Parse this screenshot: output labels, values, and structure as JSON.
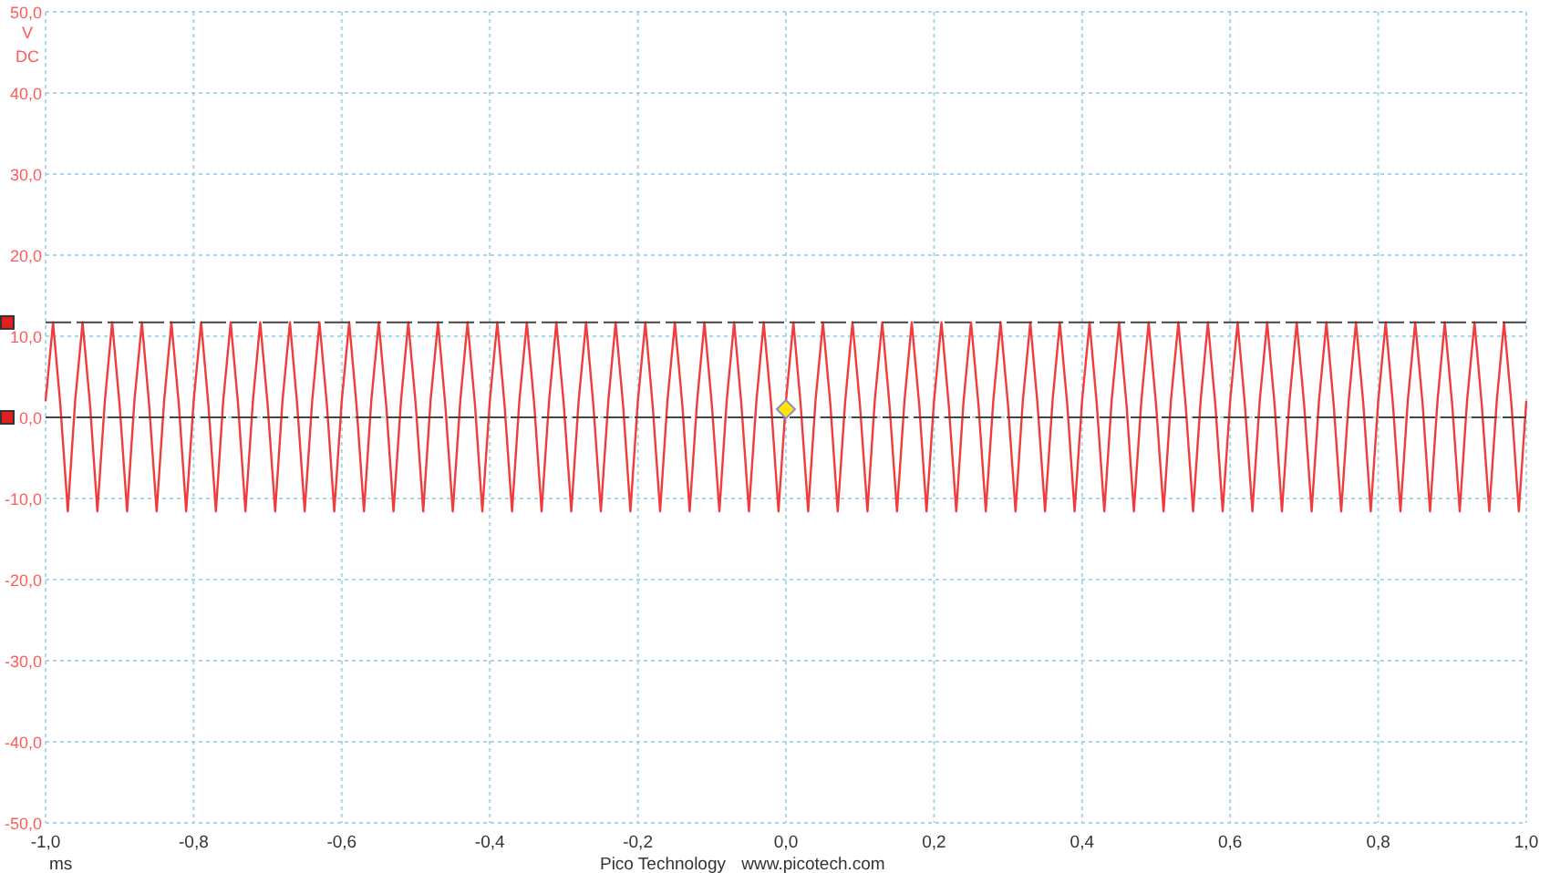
{
  "scope": {
    "coupling": "DC",
    "chart_data": {
      "type": "line",
      "xlabel": "ms",
      "ylabel": "V",
      "xlim": [
        -1,
        1
      ],
      "ylim": [
        -50,
        50
      ],
      "grid": true,
      "ref_lines": [
        {
          "axis": "y",
          "value": 11.7
        },
        {
          "axis": "y",
          "value": 0
        }
      ],
      "xticks": [
        {
          "value": -1,
          "label": "-1,0"
        },
        {
          "value": -0.8,
          "label": "-0,8"
        },
        {
          "value": -0.6,
          "label": "-0,6"
        },
        {
          "value": -0.4,
          "label": "-0,4"
        },
        {
          "value": -0.2,
          "label": "-0,2"
        },
        {
          "value": 0,
          "label": "0,0"
        },
        {
          "value": 0.2,
          "label": "0,2"
        },
        {
          "value": 0.4,
          "label": "0,4"
        },
        {
          "value": 0.6,
          "label": "0,6"
        },
        {
          "value": 0.8,
          "label": "0,8"
        },
        {
          "value": 1,
          "label": "1,0"
        }
      ],
      "yticks": [
        {
          "value": 50,
          "label": "50,0"
        },
        {
          "value": 40,
          "label": "40,0"
        },
        {
          "value": 30,
          "label": "30,0"
        },
        {
          "value": 20,
          "label": "20,0"
        },
        {
          "value": 10,
          "label": "10,0"
        },
        {
          "value": 0,
          "label": "0,0"
        },
        {
          "value": -10,
          "label": "-10,0"
        },
        {
          "value": -20,
          "label": "-20,0"
        },
        {
          "value": -30,
          "label": "-30,0"
        },
        {
          "value": -40,
          "label": "-40,0"
        },
        {
          "value": -50,
          "label": "-50,0"
        }
      ],
      "x": [
        -1,
        -0.99,
        -0.98,
        -0.97,
        -0.96,
        -0.95,
        -0.94,
        -0.93,
        -0.92,
        -0.91,
        -0.9,
        -0.89,
        -0.88,
        -0.87,
        -0.86,
        -0.85,
        -0.84,
        -0.83,
        -0.82,
        -0.81,
        -0.8,
        -0.79,
        -0.78,
        -0.77,
        -0.76,
        -0.75,
        -0.74,
        -0.73,
        -0.72,
        -0.71,
        -0.7,
        -0.69,
        -0.68,
        -0.67,
        -0.66,
        -0.65,
        -0.64,
        -0.63,
        -0.62,
        -0.61,
        -0.6,
        -0.59,
        -0.58,
        -0.57,
        -0.56,
        -0.55,
        -0.54,
        -0.53,
        -0.52,
        -0.51,
        -0.5,
        -0.49,
        -0.48,
        -0.47,
        -0.46,
        -0.45,
        -0.44,
        -0.43,
        -0.42,
        -0.41,
        -0.4,
        -0.39,
        -0.38,
        -0.37,
        -0.36,
        -0.35,
        -0.34,
        -0.33,
        -0.32,
        -0.31,
        -0.3,
        -0.29,
        -0.28,
        -0.27,
        -0.26,
        -0.25,
        -0.24,
        -0.23,
        -0.22,
        -0.21,
        -0.2,
        -0.19,
        -0.18,
        -0.17,
        -0.16,
        -0.15,
        -0.14,
        -0.13,
        -0.12,
        -0.11,
        -0.1,
        -0.09,
        -0.08,
        -0.07,
        -0.06,
        -0.05,
        -0.04,
        -0.03,
        -0.02,
        -0.01,
        0,
        0.01,
        0.02,
        0.03,
        0.04,
        0.05,
        0.06,
        0.07,
        0.08,
        0.09,
        0.1,
        0.11,
        0.12,
        0.13,
        0.14,
        0.15,
        0.16,
        0.17,
        0.18,
        0.19,
        0.2,
        0.21,
        0.22,
        0.23,
        0.24,
        0.25,
        0.26,
        0.27,
        0.28,
        0.29,
        0.3,
        0.31,
        0.32,
        0.33,
        0.34,
        0.35,
        0.36,
        0.37,
        0.38,
        0.39,
        0.4,
        0.41,
        0.42,
        0.43,
        0.44,
        0.45,
        0.46,
        0.47,
        0.48,
        0.49,
        0.5,
        0.51,
        0.52,
        0.53,
        0.54,
        0.55,
        0.56,
        0.57,
        0.58,
        0.59,
        0.6,
        0.61,
        0.62,
        0.63,
        0.64,
        0.65,
        0.66,
        0.67,
        0.68,
        0.69,
        0.7,
        0.71,
        0.72,
        0.73,
        0.74,
        0.75,
        0.76,
        0.77,
        0.78,
        0.79,
        0.8,
        0.81,
        0.82,
        0.83,
        0.84,
        0.85,
        0.86,
        0.87,
        0.88,
        0.89,
        0.9,
        0.91,
        0.92,
        0.93,
        0.94,
        0.95,
        0.96,
        0.97,
        0.98,
        0.99,
        1
      ],
      "series": [
        {
          "color": "#f03c3c",
          "values": [
            2,
            11.7,
            1.5,
            -11.6,
            2,
            11.7,
            1.5,
            -11.6,
            2,
            11.7,
            1.5,
            -11.6,
            2,
            11.7,
            1.5,
            -11.6,
            2,
            11.7,
            1.5,
            -11.6,
            2,
            11.7,
            1.5,
            -11.6,
            2,
            11.7,
            1.5,
            -11.6,
            2,
            11.7,
            1.5,
            -11.6,
            2,
            11.7,
            1.5,
            -11.6,
            2,
            11.7,
            1.5,
            -11.6,
            2,
            11.7,
            1.5,
            -11.6,
            2,
            11.7,
            1.5,
            -11.6,
            2,
            11.7,
            1.5,
            -11.6,
            2,
            11.7,
            1.5,
            -11.6,
            2,
            11.7,
            1.5,
            -11.6,
            2,
            11.7,
            1.5,
            -11.6,
            2,
            11.7,
            1.5,
            -11.6,
            2,
            11.7,
            1.5,
            -11.6,
            2,
            11.7,
            1.5,
            -11.6,
            2,
            11.7,
            1.5,
            -11.6,
            2,
            11.7,
            1.5,
            -11.6,
            2,
            11.7,
            1.5,
            -11.6,
            2,
            11.7,
            1.5,
            -11.6,
            2,
            11.7,
            1.5,
            -11.6,
            2,
            11.7,
            1.5,
            -11.6,
            2,
            11.7,
            1.5,
            -11.6,
            2,
            11.7,
            1.5,
            -11.6,
            2,
            11.7,
            1.5,
            -11.6,
            2,
            11.7,
            1.5,
            -11.6,
            2,
            11.7,
            1.5,
            -11.6,
            2,
            11.7,
            1.5,
            -11.6,
            2,
            11.7,
            1.5,
            -11.6,
            2,
            11.7,
            1.5,
            -11.6,
            2,
            11.7,
            1.5,
            -11.6,
            2,
            11.7,
            1.5,
            -11.6,
            2,
            11.7,
            1.5,
            -11.6,
            2,
            11.7,
            1.5,
            -11.6,
            2,
            11.7,
            1.5,
            -11.6,
            2,
            11.7,
            1.5,
            -11.6,
            2,
            11.7,
            1.5,
            -11.6,
            2,
            11.7,
            1.5,
            -11.6,
            2,
            11.7,
            1.5,
            -11.6,
            2,
            11.7,
            1.5,
            -11.6,
            2,
            11.7,
            1.5,
            -11.6,
            2,
            11.7,
            1.5,
            -11.6,
            2,
            11.7,
            1.5,
            -11.6,
            2,
            11.7,
            1.5,
            -11.6,
            2,
            11.7,
            1.5,
            -11.6,
            2,
            11.7,
            1.5,
            -11.6,
            2,
            11.7,
            1.5,
            -11.6,
            2
          ]
        }
      ]
    }
  },
  "footer": {
    "company": "Pico Technology",
    "website": "www.picotech.com"
  }
}
